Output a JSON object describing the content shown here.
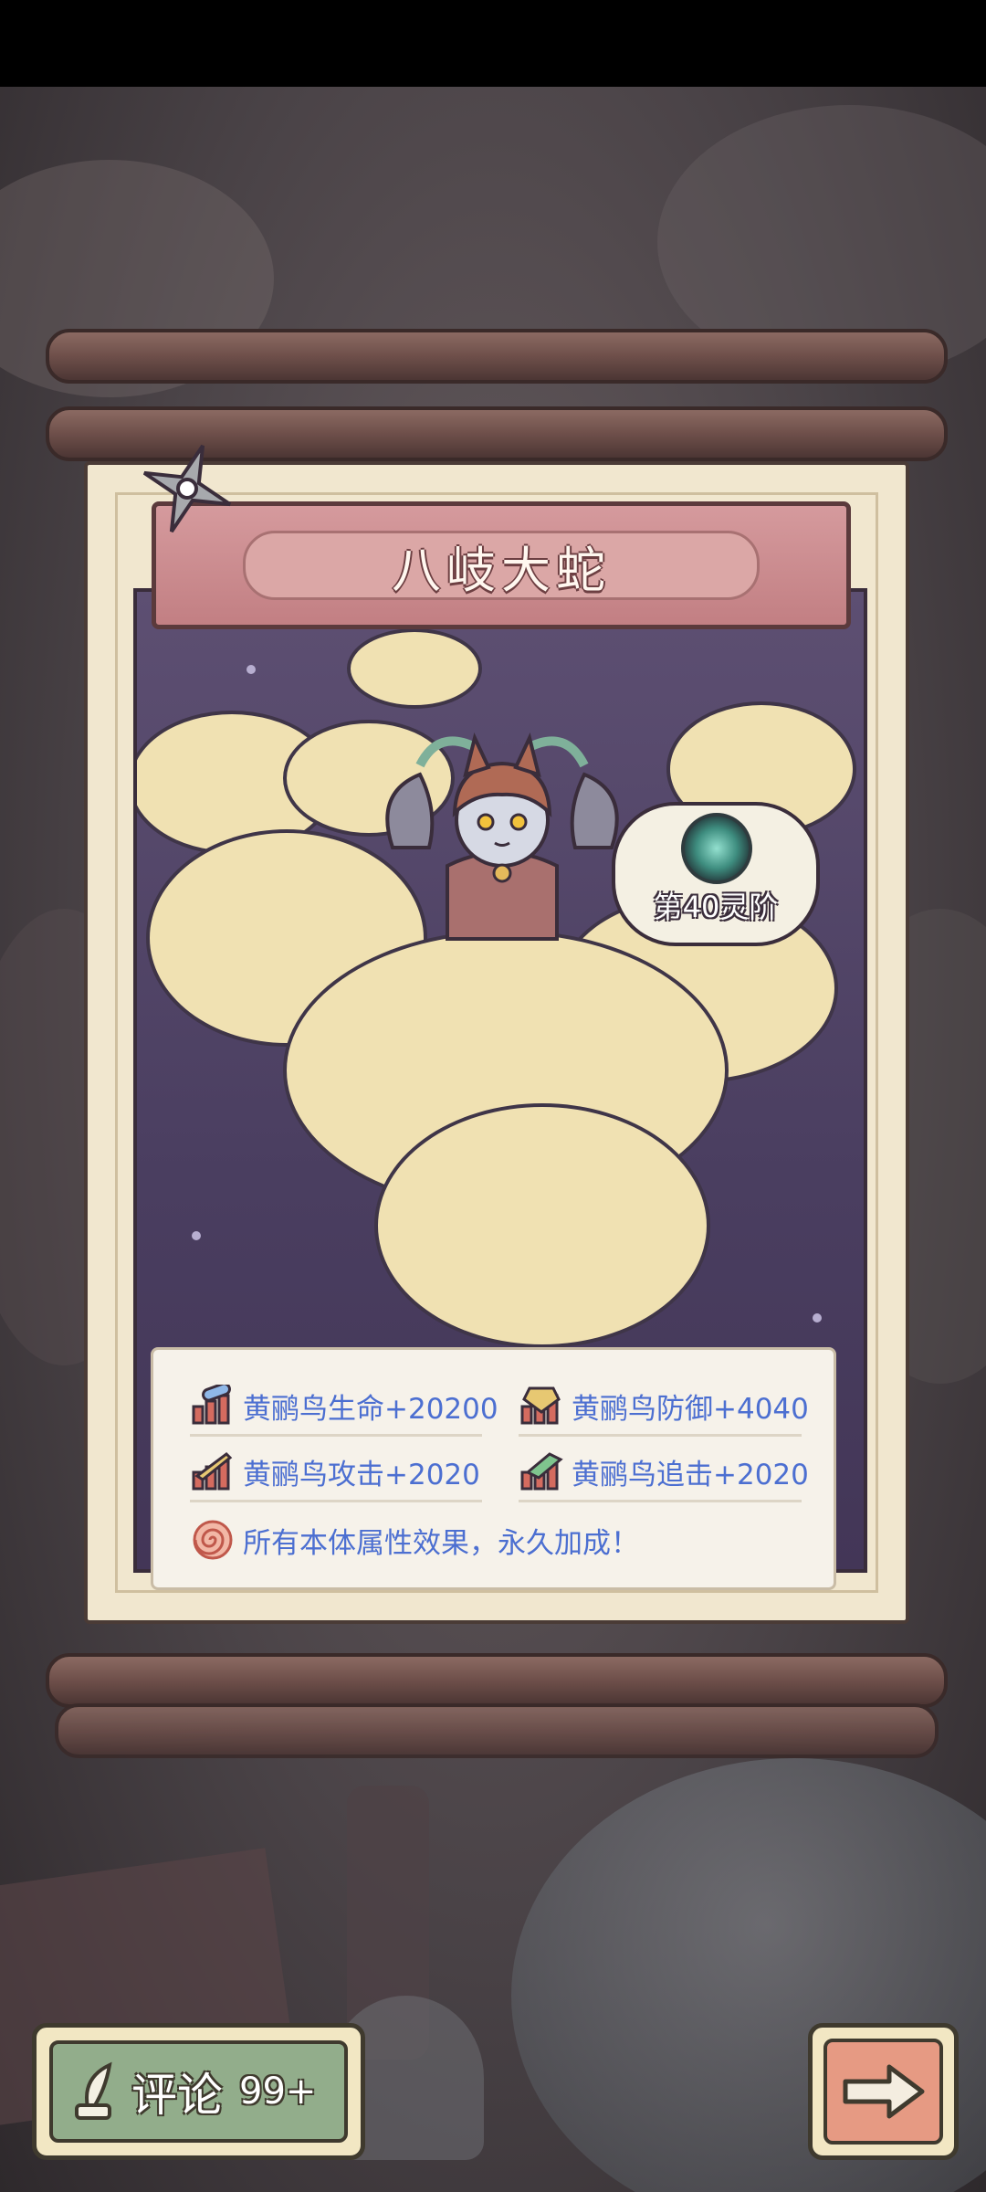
{
  "card": {
    "title": "八岐大蛇",
    "tier": "第40灵阶"
  },
  "stats": [
    {
      "icon": "health-icon",
      "text": "黄鹂鸟生命+20200"
    },
    {
      "icon": "defense-icon",
      "text": "黄鹂鸟防御+4040"
    },
    {
      "icon": "attack-icon",
      "text": "黄鹂鸟攻击+2020"
    },
    {
      "icon": "pursuit-icon",
      "text": "黄鹂鸟追击+2020"
    },
    {
      "icon": "spiral-icon",
      "text": "所有本体属性效果，永久加成！"
    }
  ],
  "buttons": {
    "comment_label": "评论",
    "comment_count": "99+"
  },
  "colors": {
    "stat_text": "#4c6fd1",
    "banner": "#c27f83",
    "art_bg": "#4a3e60",
    "comment_btn": "#92ad8b",
    "next_btn": "#e69a83"
  }
}
